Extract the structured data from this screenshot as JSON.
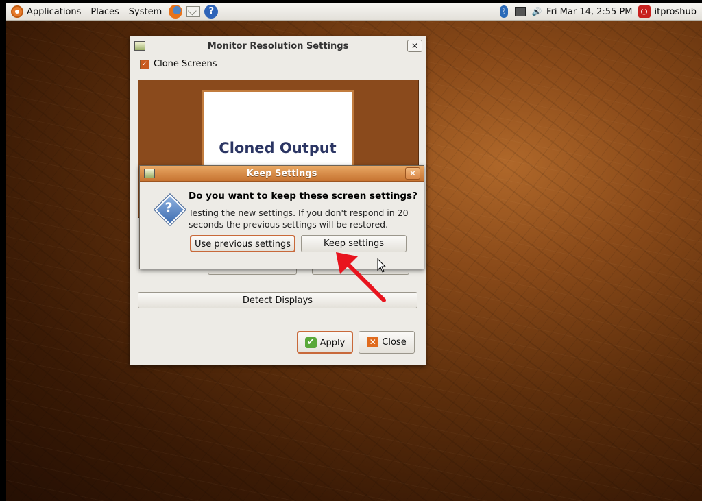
{
  "top_panel": {
    "menus": [
      "Applications",
      "Places",
      "System"
    ],
    "launchers": [
      "firefox-icon",
      "mail-icon",
      "help-icon"
    ],
    "clock": "Fri Mar 14,  2:55 PM",
    "user": "itproshub",
    "tray_icons": [
      "bluetooth-icon",
      "network-icon",
      "volume-icon",
      "quit-icon"
    ]
  },
  "main_window": {
    "title": "Monitor Resolution Settings",
    "close_glyph": "✕",
    "clone_screens_label": "Clone Screens",
    "clone_screens_checked": true,
    "monitor_label": "Cloned Output",
    "detect_displays_label": "Detect Displays",
    "apply_label": "Apply",
    "close_label": "Close"
  },
  "dialog": {
    "title": "Keep Settings",
    "close_glyph": "✕",
    "heading": "Do you want to keep these screen settings?",
    "body": "Testing the new settings. If you don't respond in 20 seconds the previous settings will be restored.",
    "use_previous_label": "Use previous settings",
    "keep_label": "Keep settings"
  },
  "colors": {
    "accent": "#c8693a",
    "dialog_title": "#d98847",
    "arrow": "#e8141e",
    "monitor_bg": "#8a4a1c",
    "monitor_text": "#2b3563"
  }
}
